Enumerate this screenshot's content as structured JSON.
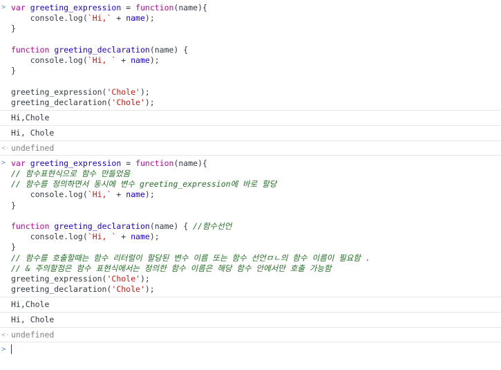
{
  "console": {
    "prompt_symbol": ">",
    "result_symbol": "<·",
    "entries": [
      {
        "kind": "input",
        "lines": [
          [
            [
              "kw",
              "var"
            ],
            [
              "p",
              " "
            ],
            [
              "var",
              "greeting_expression"
            ],
            [
              "p",
              " = "
            ],
            [
              "kw",
              "function"
            ],
            [
              "p",
              "(name){"
            ]
          ],
          [
            [
              "p",
              "    console.log("
            ],
            [
              "str",
              "`Hi,`"
            ],
            [
              "p",
              " + "
            ],
            [
              "var",
              "name"
            ],
            [
              "p",
              ");"
            ]
          ],
          [
            [
              "p",
              "}"
            ]
          ],
          [
            [
              "p",
              ""
            ]
          ],
          [
            [
              "kw",
              "function"
            ],
            [
              "p",
              " "
            ],
            [
              "fn",
              "greeting_declaration"
            ],
            [
              "p",
              "(name) {"
            ]
          ],
          [
            [
              "p",
              "    console.log("
            ],
            [
              "str",
              "`Hi, `"
            ],
            [
              "p",
              " + "
            ],
            [
              "var",
              "name"
            ],
            [
              "p",
              ");"
            ]
          ],
          [
            [
              "p",
              "}"
            ]
          ],
          [
            [
              "p",
              ""
            ]
          ],
          [
            [
              "p",
              "greeting_expression("
            ],
            [
              "str",
              "'Chole'"
            ],
            [
              "p",
              ");"
            ]
          ],
          [
            [
              "p",
              "greeting_declaration("
            ],
            [
              "str",
              "'Chole'"
            ],
            [
              "p",
              ");"
            ]
          ]
        ]
      },
      {
        "kind": "output",
        "text": "Hi,Chole"
      },
      {
        "kind": "output",
        "text": "Hi, Chole"
      },
      {
        "kind": "result",
        "text": "undefined"
      },
      {
        "kind": "input",
        "lines": [
          [
            [
              "kw",
              "var"
            ],
            [
              "p",
              " "
            ],
            [
              "var",
              "greeting_expression"
            ],
            [
              "p",
              " = "
            ],
            [
              "kw",
              "function"
            ],
            [
              "p",
              "(name){"
            ]
          ],
          [
            [
              "cmt",
              "// 함수표현식으로 함수 만들었음"
            ]
          ],
          [
            [
              "cmt",
              "// 함수를 정의하면서 동시에 변수 greeting_expression에 바로 할당"
            ]
          ],
          [
            [
              "p",
              "    console.log("
            ],
            [
              "str",
              "`Hi,`"
            ],
            [
              "p",
              " + "
            ],
            [
              "var",
              "name"
            ],
            [
              "p",
              ");"
            ]
          ],
          [
            [
              "p",
              "}"
            ]
          ],
          [
            [
              "p",
              ""
            ]
          ],
          [
            [
              "kw",
              "function"
            ],
            [
              "p",
              " "
            ],
            [
              "fn",
              "greeting_declaration"
            ],
            [
              "p",
              "(name) { "
            ],
            [
              "cmt",
              "//함수선언"
            ]
          ],
          [
            [
              "p",
              "    console.log("
            ],
            [
              "str",
              "`Hi, `"
            ],
            [
              "p",
              " + "
            ],
            [
              "var",
              "name"
            ],
            [
              "p",
              ");"
            ]
          ],
          [
            [
              "p",
              "}"
            ]
          ],
          [
            [
              "cmt",
              "// 함수를 호출할때는 함수 리터럴이 할당된 변수 이름 또는 함수 선언ㅁㄴ의 함수 이름이 필요함 ."
            ]
          ],
          [
            [
              "cmt",
              "// & 주의할점은 함수 표현식에서는 정의한 함수 이름은 해당 함수 안에서만 호출 가능함"
            ]
          ],
          [
            [
              "p",
              "greeting_expression("
            ],
            [
              "str",
              "'Chole'"
            ],
            [
              "p",
              ");"
            ]
          ],
          [
            [
              "p",
              "greeting_declaration("
            ],
            [
              "str",
              "'Chole'"
            ],
            [
              "p",
              ");"
            ]
          ]
        ]
      },
      {
        "kind": "output",
        "text": "Hi,Chole"
      },
      {
        "kind": "output",
        "text": "Hi, Chole"
      },
      {
        "kind": "result",
        "text": "undefined"
      }
    ]
  }
}
